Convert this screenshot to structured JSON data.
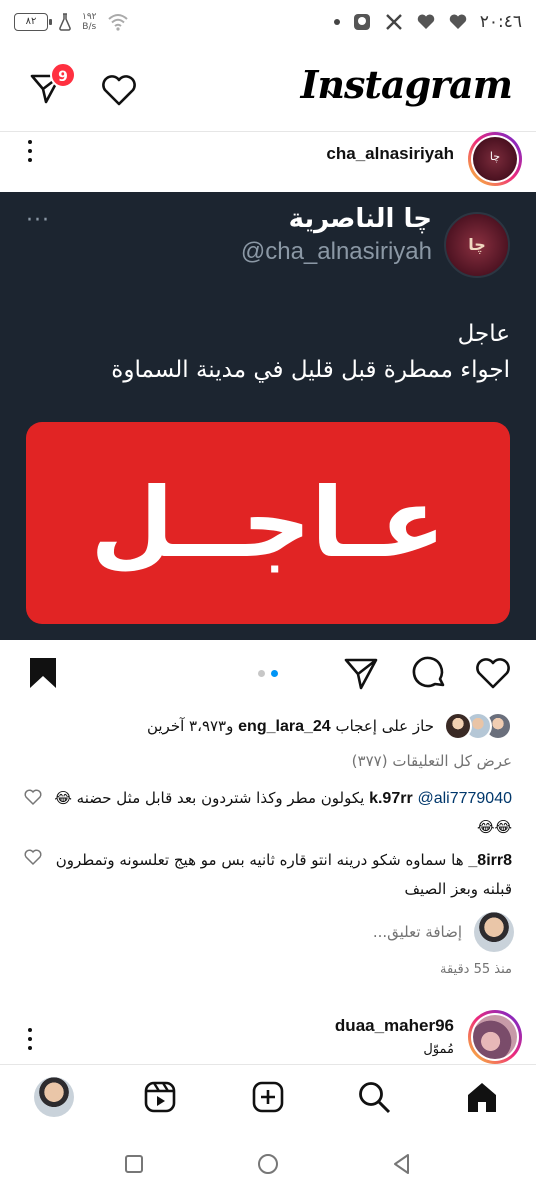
{
  "status_bar": {
    "battery": "٨٢",
    "net_speed_value": "١٩٢",
    "net_speed_unit": "B/s",
    "time": "٢٠:٤٦"
  },
  "app": {
    "logo": "Instagram",
    "messages_badge": "9"
  },
  "post": {
    "username": "cha_alnasiriyah",
    "avatar_text": "چا",
    "image": {
      "display_name": "چا الناصرية",
      "handle": "@cha_alnasiriyah",
      "avatar_text": "چا",
      "more": "···",
      "text_line1": "عاجل",
      "text_line2": "اجواء ممطرة قبل قليل في مدينة السماوة",
      "banner": "عـاجــل"
    },
    "likes": {
      "prefix": "حاز على إعجاب",
      "user": "eng_lara_24",
      "suffix": "و٣،٩٧٣ آخرين"
    },
    "view_comments": "عرض كل التعليقات (٣٧٧)",
    "comments": [
      {
        "user": "k.97rr",
        "mention": "@ali7779040",
        "text": "يكولون مطر وكذا شتردون بعد قابل مثل حضنه 😂😂😂"
      },
      {
        "user": "8irr8_",
        "mention": "",
        "text": "ها سماوه شكو درينه انتو قاره ثانيه بس مو هيج تعلسونه وتمطرون قبلنه وبعز الصيف"
      }
    ],
    "add_comment_placeholder": "إضافة تعليق...",
    "time_ago": "منذ 55 دقيقة"
  },
  "next_post": {
    "username": "duaa_maher96",
    "sponsored": "مُموّل"
  },
  "colors": {
    "badge": "#ff3040",
    "link": "#00376b",
    "carousel_active": "#0095f6",
    "banner": "#e12424",
    "tweet_bg": "#1c2530"
  },
  "carousel": {
    "count": 2,
    "active_index": 1
  }
}
